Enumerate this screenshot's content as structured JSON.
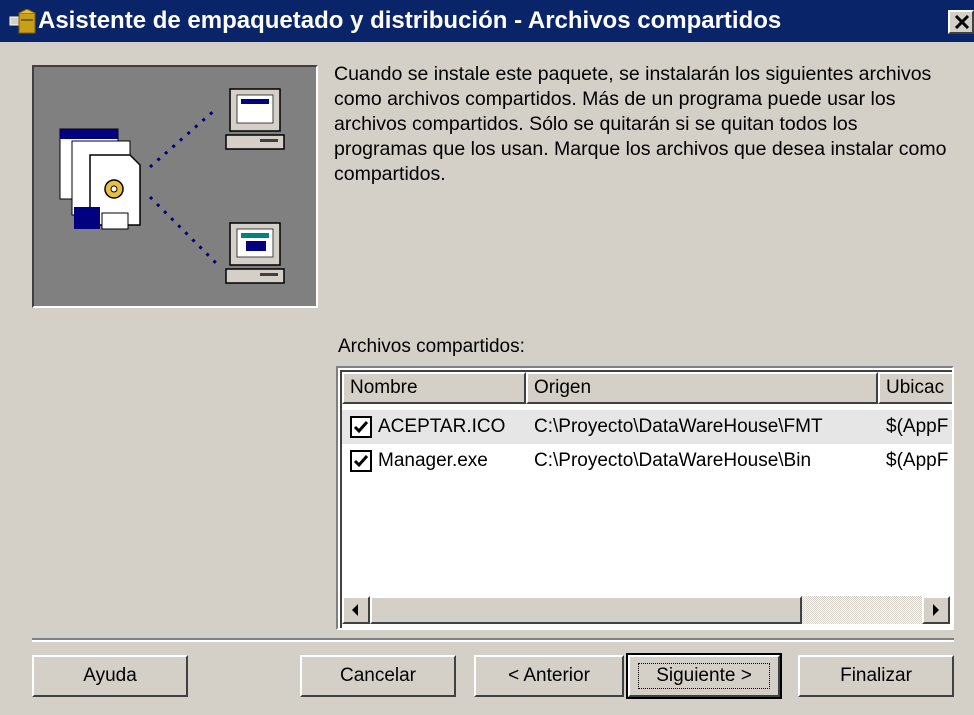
{
  "window": {
    "title": "Asistente de empaquetado y distribución - Archivos compartidos"
  },
  "intro_text": "Cuando se instale este paquete, se instalarán los siguientes archivos como archivos compartidos. Más de un programa puede usar los archivos compartidos. Sólo se quitarán si se quitan todos los programas que los usan. Marque los archivos que desea instalar como compartidos.",
  "list": {
    "label": "Archivos compartidos:",
    "columns": [
      "Nombre",
      "Origen",
      "Ubicac"
    ],
    "rows": [
      {
        "checked": true,
        "name": "ACEPTAR.ICO",
        "source": "C:\\Proyecto\\DataWareHouse\\FMT",
        "location": "$(AppF"
      },
      {
        "checked": true,
        "name": "Manager.exe",
        "source": "C:\\Proyecto\\DataWareHouse\\Bin",
        "location": "$(AppF"
      }
    ]
  },
  "buttons": {
    "help": "Ayuda",
    "cancel": "Cancelar",
    "back": "< Anterior",
    "next": "Siguiente >",
    "finish": "Finalizar"
  },
  "colors": {
    "titlebar": "#0a246a",
    "face": "#d4d0c8",
    "selected_row": "#e6e6e6"
  },
  "icons": [
    "package-wizard-icon",
    "close-icon",
    "document-gear-icon",
    "computer-icon",
    "arrow-left-icon",
    "arrow-right-icon",
    "checkbox-check-icon"
  ]
}
